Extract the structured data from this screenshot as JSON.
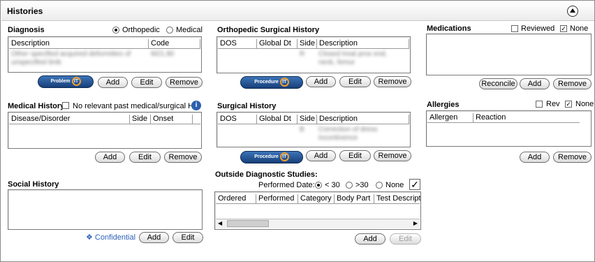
{
  "window": {
    "title": "Histories"
  },
  "diagnosis": {
    "title": "Diagnosis",
    "radio_orthopedic": "Orthopedic",
    "radio_medical": "Medical",
    "col_description": "Description",
    "col_code": "Code",
    "row_description": "Other specified acquired deformities of unspecified limb",
    "row_code": "M21.80",
    "problem_it_label": "Problem",
    "it": "IT",
    "add": "Add",
    "edit": "Edit",
    "remove": "Remove"
  },
  "ortho_surgical": {
    "title": "Orthopedic Surgical History",
    "cols": [
      "DOS",
      "Global Dt",
      "Side",
      "Description"
    ],
    "row_side": "R",
    "row_description": "Closed treat prox end, neck, femur",
    "procedure_label": "Procedure",
    "it": "IT",
    "add": "Add",
    "edit": "Edit",
    "remove": "Remove"
  },
  "medications": {
    "title": "Medications",
    "reviewed": "Reviewed",
    "none": "None",
    "none_checked": "✓",
    "reconcile": "Reconcile",
    "add": "Add",
    "remove": "Remove"
  },
  "medical_history": {
    "title": "Medical History",
    "no_relevant": "No relevant past medical/surgical Hx",
    "info": "i",
    "cols": [
      "Disease/Disorder",
      "Side",
      "Onset"
    ],
    "add": "Add",
    "edit": "Edit",
    "remove": "Remove"
  },
  "surgical_history": {
    "title": "Surgical History",
    "cols": [
      "DOS",
      "Global Dt",
      "Side",
      "Description"
    ],
    "row_side": "B",
    "row_description": "Correction of dress incontinence",
    "procedure_label": "Procedure",
    "it": "IT",
    "add": "Add",
    "edit": "Edit",
    "remove": "Remove"
  },
  "allergies": {
    "title": "Allergies",
    "rev": "Rev",
    "none": "None",
    "none_checked": "✓",
    "cols": [
      "Allergen",
      "Reaction"
    ],
    "add": "Add",
    "remove": "Remove"
  },
  "social_history": {
    "title": "Social History",
    "confidential": "❖ Confidential",
    "add": "Add",
    "edit": "Edit"
  },
  "outside_studies": {
    "title": "Outside Diagnostic Studies:",
    "performed_date": "Performed Date:",
    "opt_lt30": "< 30",
    "opt_gt30": ">30",
    "opt_none": "None",
    "check": "✓",
    "cols": [
      "Ordered",
      "Performed",
      "Category",
      "Body Part",
      "Test Description"
    ],
    "scroll_left": "◀",
    "scroll_right": "▶",
    "add": "Add",
    "edit": "Edit"
  }
}
